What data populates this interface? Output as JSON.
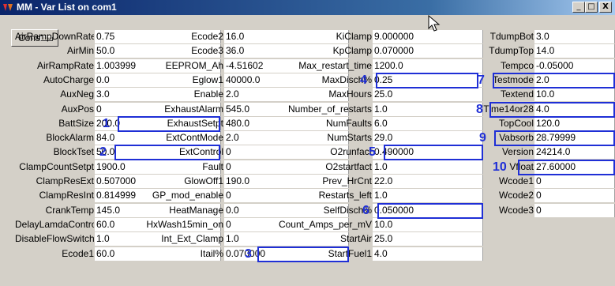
{
  "window": {
    "title": "MM - Var List on com1",
    "minimize": "_",
    "maximize": "□",
    "close": "X"
  },
  "consts_button": "Consts",
  "columns": [
    {
      "rows": [
        {
          "label": "AirRampDownRate",
          "value": "0.75"
        },
        {
          "label": "AirMin",
          "value": "50.0"
        },
        {
          "label": "AirRampRate",
          "value": "1.003999"
        },
        {
          "label": "AutoCharge",
          "value": "0.0"
        },
        {
          "label": "AuxNeg",
          "value": "3.0"
        },
        {
          "label": "AuxPos",
          "value": "0"
        },
        {
          "label": "BattSize",
          "value": "200.0"
        },
        {
          "label": "BlockAlarm",
          "value": "84.0"
        },
        {
          "label": "BlockTset",
          "value": "50.0"
        },
        {
          "label": "ClampCountSetpt",
          "value": "1900.0"
        },
        {
          "label": "ClampResExt",
          "value": "0.507000"
        },
        {
          "label": "ClampResInt",
          "value": "0.814999"
        },
        {
          "label": "CrankTemp",
          "value": "145.0"
        },
        {
          "label": "DelayLamdaControl",
          "value": "60.0"
        },
        {
          "label": "DisableFlowSwitch",
          "value": "1.0"
        },
        {
          "label": "Ecode1",
          "value": "60.0"
        }
      ]
    },
    {
      "rows": [
        {
          "label": "Ecode2",
          "value": "16.0"
        },
        {
          "label": "Ecode3",
          "value": "36.0"
        },
        {
          "label": "EEPROM_Ah",
          "value": "-4.51602"
        },
        {
          "label": "Eglow1",
          "value": "40000.0"
        },
        {
          "label": "Enable",
          "value": "2.0"
        },
        {
          "label": "ExhaustAlarm",
          "value": "545.0"
        },
        {
          "label": "ExhaustSetpt",
          "value": "480.0"
        },
        {
          "label": "ExtContMode",
          "value": "2.0"
        },
        {
          "label": "ExtControl",
          "value": "0"
        },
        {
          "label": "Fault",
          "value": "0"
        },
        {
          "label": "GlowOff1",
          "value": "190.0"
        },
        {
          "label": "GP_mod_enable",
          "value": "0"
        },
        {
          "label": "HeatManage",
          "value": "0.0"
        },
        {
          "label": "HxWash15min_on",
          "value": "0"
        },
        {
          "label": "Int_Ext_Clamp",
          "value": "1.0"
        },
        {
          "label": "Itail%",
          "value": "0.070000"
        }
      ]
    },
    {
      "rows": [
        {
          "label": "KiClamp",
          "value": "9.000000"
        },
        {
          "label": "KpClamp",
          "value": "0.070000"
        },
        {
          "label": "Max_restart_time",
          "value": "1200.0"
        },
        {
          "label": "MaxDisch%",
          "value": "0.25"
        },
        {
          "label": "MaxHours",
          "value": "25.0"
        },
        {
          "label": "Number_of_restarts",
          "value": "1.0"
        },
        {
          "label": "NumFaults",
          "value": "6.0"
        },
        {
          "label": "NumStarts",
          "value": "29.0"
        },
        {
          "label": "O2runfact",
          "value": "0.490000"
        },
        {
          "label": "O2startfact",
          "value": "1.0"
        },
        {
          "label": "Prev_HrCnt",
          "value": "22.0"
        },
        {
          "label": "Restarts_left",
          "value": "1.0"
        },
        {
          "label": "SelfDisch%",
          "value": "0.050000"
        },
        {
          "label": "Count_Amps_per_mV",
          "value": "10.0"
        },
        {
          "label": "StartAir",
          "value": "25.0"
        },
        {
          "label": "StartFuel1",
          "value": "4.0"
        }
      ]
    },
    {
      "rows": [
        {
          "label": "TdumpBot",
          "value": "3.0"
        },
        {
          "label": "TdumpTop",
          "value": "14.0"
        },
        {
          "label": "Tempco",
          "value": "-0.05000"
        },
        {
          "label": "Testmode",
          "value": "2.0"
        },
        {
          "label": "Textend",
          "value": "10.0"
        },
        {
          "label": "Time14or28",
          "value": "4.0"
        },
        {
          "label": "TopCool",
          "value": "120.0"
        },
        {
          "label": "Vabsorb",
          "value": "28.79999"
        },
        {
          "label": "Version",
          "value": "24214.0"
        },
        {
          "label": "Vfloat",
          "value": "27.60000"
        },
        {
          "label": "Wcode1",
          "value": "0"
        },
        {
          "label": "Wcode2",
          "value": "0"
        },
        {
          "label": "Wcode3",
          "value": "0"
        }
      ]
    }
  ],
  "annotations": [
    {
      "number": "1",
      "target": "BattSize"
    },
    {
      "number": "2",
      "target": "BlockTset"
    },
    {
      "number": "3",
      "target": "Itail%"
    },
    {
      "number": "4",
      "target": "MaxDisch%"
    },
    {
      "number": "5",
      "target": "O2runfact"
    },
    {
      "number": "6",
      "target": "SelfDisch%"
    },
    {
      "number": "7",
      "target": "Testmode"
    },
    {
      "number": "8",
      "target": "Time14or28"
    },
    {
      "number": "9",
      "target": "Vabsorb"
    },
    {
      "number": "10",
      "target": "Vfloat"
    }
  ],
  "colors": {
    "annotation": "#1f2fd6",
    "titlebar_start": "#0a246a",
    "titlebar_end": "#a6caf0"
  }
}
